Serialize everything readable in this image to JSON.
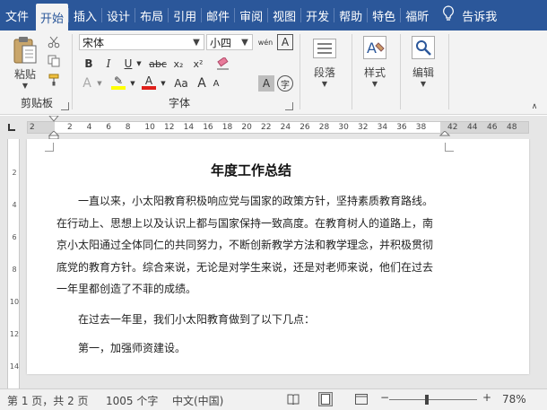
{
  "tabs": [
    {
      "label": "文件",
      "active": false
    },
    {
      "label": "开始",
      "active": true
    },
    {
      "label": "插入",
      "active": false
    },
    {
      "label": "设计",
      "active": false
    },
    {
      "label": "布局",
      "active": false
    },
    {
      "label": "引用",
      "active": false
    },
    {
      "label": "邮件",
      "active": false
    },
    {
      "label": "审阅",
      "active": false
    },
    {
      "label": "视图",
      "active": false
    },
    {
      "label": "开发",
      "active": false
    },
    {
      "label": "帮助",
      "active": false
    },
    {
      "label": "特色",
      "active": false
    },
    {
      "label": "福昕",
      "active": false
    }
  ],
  "tell_me": "告诉我",
  "ribbon": {
    "clipboard": {
      "paste_label": "粘贴",
      "group_label": "剪贴板"
    },
    "font": {
      "font_name": "宋体",
      "font_size": "小四",
      "pinyin_glyph": "wén",
      "border_glyph": "A",
      "bold": "B",
      "italic": "I",
      "underline": "U",
      "strike": "abc",
      "subscript": "x₂",
      "superscript": "x²",
      "highlight_letter": "A",
      "font_color_letter": "A",
      "aa_letter": "Aa",
      "grow_letter": "A",
      "shrink_letter": "A",
      "char_shade": "A",
      "enclose_char": "字",
      "group_label": "字体",
      "highlight_color": "#ffff00",
      "font_color": "#e0201b"
    },
    "paragraph": {
      "label": "段落"
    },
    "styles": {
      "label": "样式"
    },
    "editing": {
      "label": "编辑"
    }
  },
  "ruler": {
    "left_numbers": [
      "2"
    ],
    "numbers": [
      "2",
      "4",
      "6",
      "8",
      "10",
      "12",
      "14",
      "16",
      "18",
      "20",
      "22",
      "24",
      "26",
      "28",
      "30",
      "32",
      "34",
      "36",
      "38"
    ],
    "right_numbers": [
      "42",
      "44",
      "46",
      "48"
    ]
  },
  "vruler_numbers": [
    "2",
    "4",
    "6",
    "8",
    "10",
    "12",
    "14"
  ],
  "document": {
    "title": "年度工作总结",
    "para1": "一直以来，小太阳教育积极响应党与国家的政策方针，坚持素质教育路线。在行动上、思想上以及认识上都与国家保持一致高度。在教育树人的道路上，南京小太阳通过全体同仁的共同努力，不断创新教学方法和教学理念，并积极贯彻底党的教育方针。综合来说，无论是对学生来说，还是对老师来说，他们在过去一年里都创造了不菲的成绩。",
    "para1_lines": [
      "一直以来，小太阳教育积极响应党与国家的政策方针，坚持素质教育路线。",
      "在行动上、思想上以及认识上都与国家保持一致高度。在教育树人的道路上，南",
      "京小太阳通过全体同仁的共同努力，不断创新教学方法和教学理念，并积极贯彻",
      "底党的教育方针。综合来说，无论是对学生来说，还是对老师来说，他们在过去",
      "一年里都创造了不菲的成绩。"
    ],
    "para2": "在过去一年里，我们小太阳教育做到了以下几点：",
    "para3": "第一，加强师资建设。"
  },
  "status": {
    "page": "第 1 页，共 2 页",
    "words": "1005 个字",
    "language": "中文(中国)",
    "zoom": "78%",
    "zoom_minus": "−",
    "zoom_plus": "+"
  }
}
